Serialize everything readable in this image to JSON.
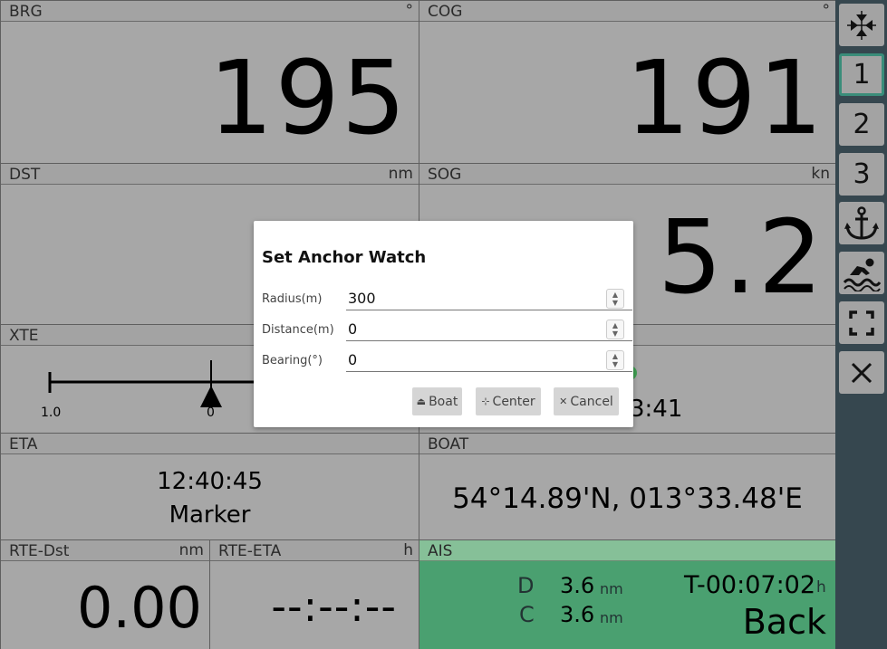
{
  "panels": {
    "brg": {
      "label": "BRG",
      "unit": "°",
      "value": "195"
    },
    "cog": {
      "label": "COG",
      "unit": "°",
      "value": "191"
    },
    "dst": {
      "label": "DST",
      "unit": "nm",
      "value": ""
    },
    "sog": {
      "label": "SOG",
      "unit": "kn",
      "value": "5.2"
    },
    "xte": {
      "label": "XTE",
      "left_tick": "1.0",
      "center_tick": "0"
    },
    "partial": {
      "value": "3:41"
    },
    "eta": {
      "label": "ETA",
      "time": "12:40:45",
      "name": "Marker"
    },
    "boat": {
      "label": "BOAT",
      "position": "54°14.89'N, 013°33.48'E"
    },
    "rte_dst": {
      "label": "RTE-Dst",
      "unit": "nm",
      "value": "0.00"
    },
    "rte_eta": {
      "label": "RTE-ETA",
      "unit": "h",
      "value": "--:--:--"
    },
    "ais": {
      "label": "AIS",
      "d_label": "D",
      "d_value": "3.6",
      "d_unit": "nm",
      "c_label": "C",
      "c_value": "3.6",
      "c_unit": "nm",
      "t_value": "T-00:07:02",
      "t_unit": "h",
      "name": "Back",
      "color": "#4aa070"
    }
  },
  "sidebar": {
    "buttons": [
      {
        "icon": "compress-icon",
        "label": ""
      },
      {
        "icon": "",
        "label": "1",
        "active": true
      },
      {
        "icon": "",
        "label": "2"
      },
      {
        "icon": "",
        "label": "3"
      },
      {
        "icon": "anchor-icon",
        "label": ""
      },
      {
        "icon": "man-overboard-icon",
        "label": ""
      },
      {
        "icon": "fullscreen-icon",
        "label": ""
      },
      {
        "icon": "close-icon",
        "label": ""
      }
    ],
    "color": "#36474f"
  },
  "dialog": {
    "title": "Set Anchor Watch",
    "fields": [
      {
        "label": "Radius(m)",
        "value": "300"
      },
      {
        "label": "Distance(m)",
        "value": "0"
      },
      {
        "label": "Bearing(°)",
        "value": "0"
      }
    ],
    "buttons": {
      "boat": {
        "icon": "boat-icon",
        "label": "Boat"
      },
      "center": {
        "icon": "crosshair-icon",
        "label": "Center"
      },
      "cancel": {
        "icon": "close-icon",
        "label": "Cancel"
      }
    }
  }
}
